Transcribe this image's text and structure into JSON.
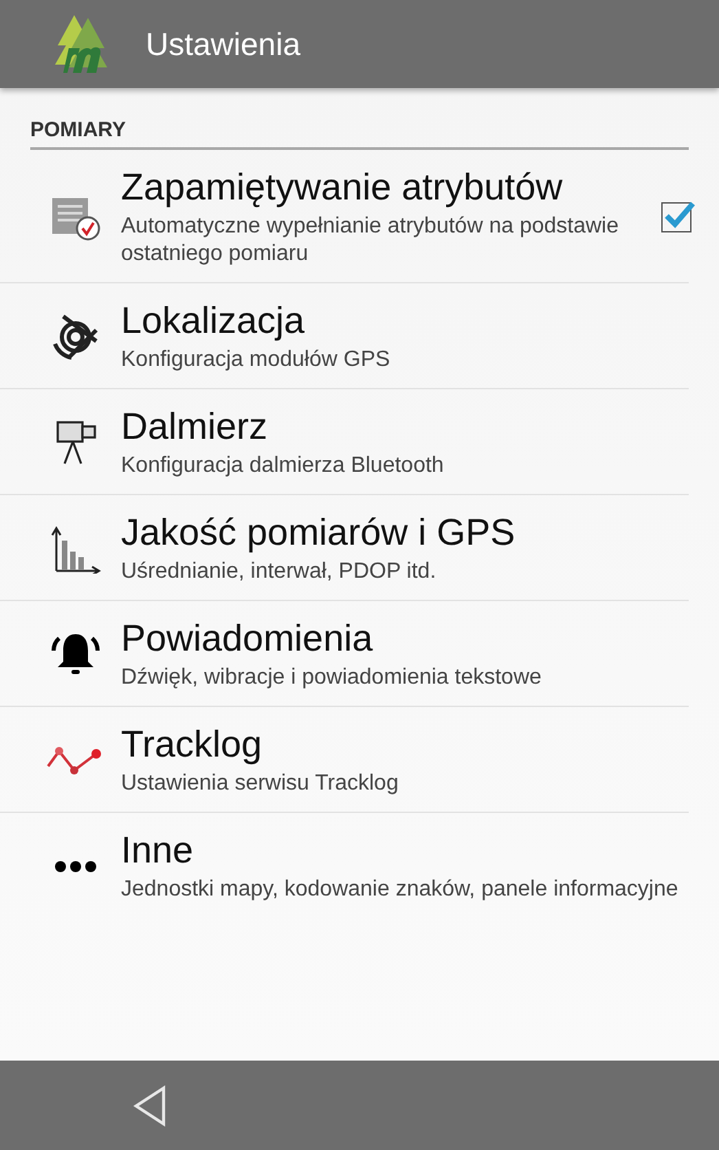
{
  "app_bar": {
    "title": "Ustawienia"
  },
  "section": {
    "title": "POMIARY"
  },
  "items": [
    {
      "kind": "attributes",
      "title": "Zapamiętywanie atrybutów",
      "summary": "Automatyczne wypełnianie atrybutów na podstawie ostatniego pomiaru",
      "checked": true
    },
    {
      "kind": "location",
      "title": "Lokalizacja",
      "summary": "Konfiguracja modułów GPS"
    },
    {
      "kind": "rangefinder",
      "title": "Dalmierz",
      "summary": "Konfiguracja dalmierza Bluetooth"
    },
    {
      "kind": "quality",
      "title": "Jakość pomiarów i GPS",
      "summary": "Uśrednianie, interwał, PDOP itd."
    },
    {
      "kind": "notifications",
      "title": "Powiadomienia",
      "summary": "Dźwięk, wibracje i powiadomienia tekstowe"
    },
    {
      "kind": "tracklog",
      "title": "Tracklog",
      "summary": "Ustawienia serwisu Tracklog"
    },
    {
      "kind": "other",
      "title": "Inne",
      "summary": "Jednostki mapy, kodowanie znaków, panele informacyjne"
    }
  ]
}
